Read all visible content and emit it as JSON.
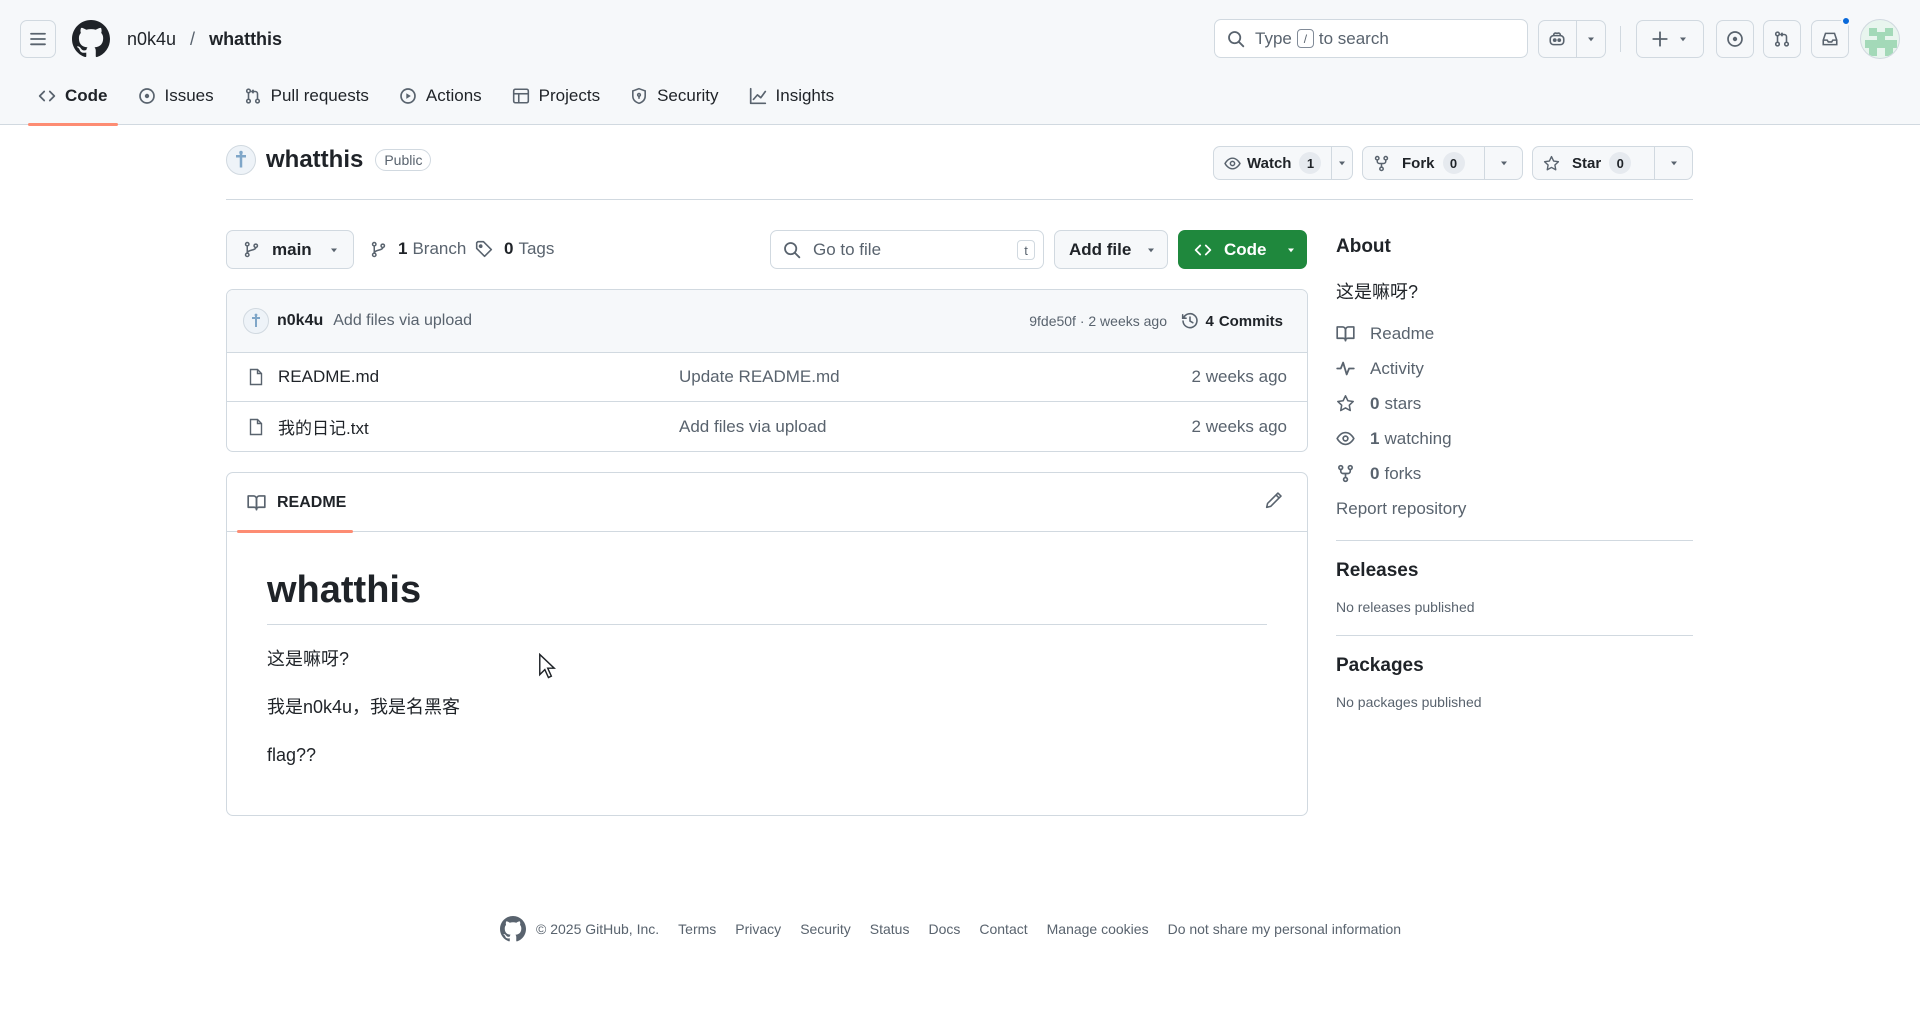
{
  "header": {
    "owner": "n0k4u",
    "separator": "/",
    "repo": "whatthis",
    "search": {
      "prefix": "Type",
      "key": "/",
      "suffix": "to search"
    },
    "notification_dot_color": "#0969da"
  },
  "repo_nav": {
    "tabs": [
      {
        "label": "Code",
        "icon": "code-icon",
        "active": true
      },
      {
        "label": "Issues",
        "icon": "issue-icon"
      },
      {
        "label": "Pull requests",
        "icon": "pull-request-icon"
      },
      {
        "label": "Actions",
        "icon": "play-icon"
      },
      {
        "label": "Projects",
        "icon": "table-icon"
      },
      {
        "label": "Security",
        "icon": "shield-icon"
      },
      {
        "label": "Insights",
        "icon": "graph-icon"
      }
    ]
  },
  "repo_header": {
    "name": "whatthis",
    "visibility": "Public",
    "watch": {
      "label": "Watch",
      "count": "1"
    },
    "fork": {
      "label": "Fork",
      "count": "0"
    },
    "star": {
      "label": "Star",
      "count": "0"
    }
  },
  "file_controls": {
    "branch": "main",
    "branches_count": "1",
    "branches_label": "Branch",
    "tags_count": "0",
    "tags_label": "Tags",
    "go_to_file_placeholder": "Go to file",
    "go_to_file_key": "t",
    "add_file": "Add file",
    "code": "Code"
  },
  "latest_commit": {
    "author": "n0k4u",
    "message": "Add files via upload",
    "meta": "9fde50f · 2 weeks ago",
    "commits_count": "4",
    "commits_label": "Commits"
  },
  "files": [
    {
      "name": "README.md",
      "message": "Update README.md",
      "date": "2 weeks ago"
    },
    {
      "name": "我的日记.txt",
      "message": "Add files via upload",
      "date": "2 weeks ago"
    }
  ],
  "readme": {
    "tab": "README",
    "title": "whatthis",
    "paragraphs": [
      "这是嘛呀?",
      "我是n0k4u，我是名黑客",
      "flag??"
    ]
  },
  "sidebar": {
    "about_title": "About",
    "description": "这是嘛呀?",
    "readme": "Readme",
    "activity": "Activity",
    "stars_count": "0",
    "stars_label": "stars",
    "watching_count": "1",
    "watching_label": "watching",
    "forks_count": "0",
    "forks_label": "forks",
    "report": "Report repository",
    "releases_title": "Releases",
    "releases_empty": "No releases published",
    "packages_title": "Packages",
    "packages_empty": "No packages published"
  },
  "footer": {
    "copyright": "© 2025 GitHub, Inc.",
    "links": [
      "Terms",
      "Privacy",
      "Security",
      "Status",
      "Docs",
      "Contact",
      "Manage cookies",
      "Do not share my personal information"
    ]
  },
  "colors": {
    "accent_underline": "#fd8c73",
    "primary_button": "#1f883d",
    "border": "#d1d9e0",
    "muted_text": "#59636e"
  }
}
